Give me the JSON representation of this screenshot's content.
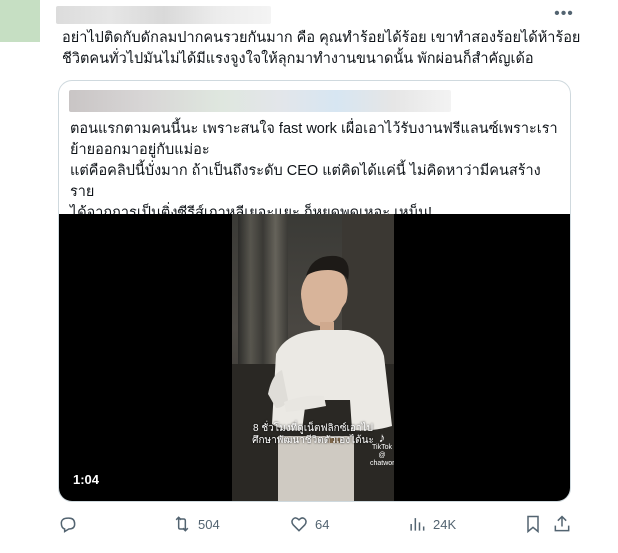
{
  "tweet": {
    "text_lines": [
      "อย่าไปติดกับดักลมปากคนรวยกันมาก คือ คุณทำร้อยได้ร้อย เขาทำสองร้อยได้ห้าร้อย",
      "ชีวิตคนทั่วไปมันไม่ได้มีแรงจูงใจให้ลุกมาทำงานขนาดนั้น พักผ่อนก็สำคัญเด้อ"
    ],
    "more_icon": "more-horizontal-icon"
  },
  "quote": {
    "text_lines": [
      "ตอนแรกตามคนนี้นะ เพราะสนใจ fast work เผื่อเอาไว้รับงานฟรีแลนซ์เพราะเรา",
      "ย้ายออกมาอยู่กับแม่อะ",
      "แต่คือคลิปนี้บั่งมาก ถ้าเป็นถึงระดับ CEO แต่คิดได้แค่นี้ ไม่คิดหาว่ามีคนสร้างราย",
      "ได้จากการเป็นติ่งซีรีส์เกาหลีเยอะแยะ ก็หยุดพูดเหอะ เหม็น!"
    ],
    "video": {
      "caption_line1": "8 ชั่วโมงที่ดูเน็ตฟลิกซ์เอาไป",
      "caption_line2": "ศึกษาพัฒนาชีวิตตัวเองได้นะ",
      "tiktok_label": "TikTok",
      "tiktok_handle": "@ chatwork",
      "duration": "1:04"
    }
  },
  "actions": {
    "reply": {
      "icon": "reply-icon",
      "count": ""
    },
    "retweet": {
      "icon": "retweet-icon",
      "count": "504"
    },
    "like": {
      "icon": "heart-icon",
      "count": "64"
    },
    "views": {
      "icon": "views-icon",
      "count": "24K"
    },
    "bookmark": {
      "icon": "bookmark-icon",
      "count": ""
    },
    "share": {
      "icon": "share-icon",
      "count": ""
    }
  },
  "colors": {
    "muted": "#536471",
    "border": "#cfd9de",
    "text": "#0f1419"
  }
}
